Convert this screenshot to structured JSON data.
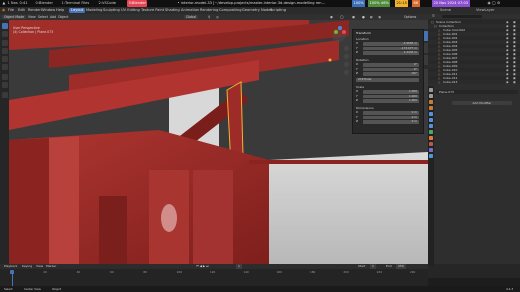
{
  "system_bar": {
    "workspace_icon": "arch-logo-icon",
    "items": [
      "1 Nas",
      "0:41",
      "0:Blender",
      "1:Terminal Files",
      "2:VSCode"
    ],
    "active": "3:Blender",
    "window_title": "• interior-model-33 [~/develop-projects/master-interior-3d-design-modelling ren...",
    "status": [
      "100%",
      "100% 46%",
      "21:15",
      "66",
      "20 Nov 2024 07:03"
    ],
    "active_color": "#e64553",
    "warn_color": "#f2b22c"
  },
  "menubar": {
    "menus": [
      "File",
      "Edit",
      "Render",
      "Window",
      "Help"
    ],
    "workspaces": [
      "Layout",
      "Modeling",
      "Sculpting",
      "UV Editing",
      "Texture Paint",
      "Shading",
      "Animation",
      "Rendering",
      "Compositing",
      "Geometry Nodes",
      "Scripting"
    ],
    "active_workspace": "Layout",
    "scene": "Scene",
    "view_layer": "ViewLayer"
  },
  "viewport_header": {
    "mode": "Object Mode",
    "menus": [
      "View",
      "Select",
      "Add",
      "Object"
    ],
    "transform": "Global",
    "options": "Options"
  },
  "viewport_overlay": {
    "view_name": "User Perspective",
    "collection": "(4) Collection | Plane.073"
  },
  "npanel": {
    "title": "Transform",
    "location_label": "Location",
    "location": [
      {
        "axis": "X",
        "value": "-3.9685 m"
      },
      {
        "axis": "Y",
        "value": "-173.977 m"
      },
      {
        "axis": "Z",
        "value": "1.4445 m"
      }
    ],
    "rotation_label": "Rotation",
    "rotation": [
      {
        "axis": "X",
        "value": "0°"
      },
      {
        "axis": "Y",
        "value": "0°"
      },
      {
        "axis": "Z",
        "value": "-90°"
      }
    ],
    "mode": "XYZ Euler",
    "scale_label": "Scale",
    "scale": [
      {
        "axis": "X",
        "value": "1.000"
      },
      {
        "axis": "Y",
        "value": "1.000"
      },
      {
        "axis": "Z",
        "value": "1.000"
      }
    ],
    "dimensions_label": "Dimensions",
    "dimensions": [
      {
        "axis": "X",
        "value": "0 m"
      },
      {
        "axis": "Y",
        "value": "0 m"
      },
      {
        "axis": "Z",
        "value": "0 m"
      }
    ],
    "tabs": [
      "Item",
      "Tool",
      "View"
    ]
  },
  "outliner": {
    "rows": [
      "Scene Collection",
      "Collection",
      "Cube.mod.002",
      "Cube.001",
      "Cube.002",
      "Cube.003",
      "Cube.004",
      "Cube.005",
      "Cube.006",
      "Cube.007",
      "Cube.008",
      "Cube.009",
      "Cube.010",
      "Cube.011",
      "Cube.012",
      "Cube.013"
    ]
  },
  "properties": {
    "object_name": "Plane.073",
    "add_modifier": "Add Modifier",
    "tab_colors": [
      "#9a9a9a",
      "#9a9a9a",
      "#c77b37",
      "#c77b37",
      "#5c8fd6",
      "#5c8fd6",
      "#5c8fd6",
      "#4fa56b",
      "#e07a3f",
      "#b05d4e",
      "#7e6acb",
      "#4a9bd1"
    ]
  },
  "timeline": {
    "menus": [
      "Playback",
      "Keying",
      "View",
      "Marker"
    ],
    "frame": "1",
    "start": "Start",
    "start_value": "1",
    "end": "End",
    "end_value": "250",
    "ticks": [
      "0",
      "20",
      "40",
      "60",
      "80",
      "100",
      "120",
      "140",
      "160",
      "180",
      "200",
      "220",
      "240"
    ]
  },
  "statusbar": {
    "left": [
      "Select",
      "Center View",
      "Object"
    ],
    "right": "4.2.3"
  }
}
